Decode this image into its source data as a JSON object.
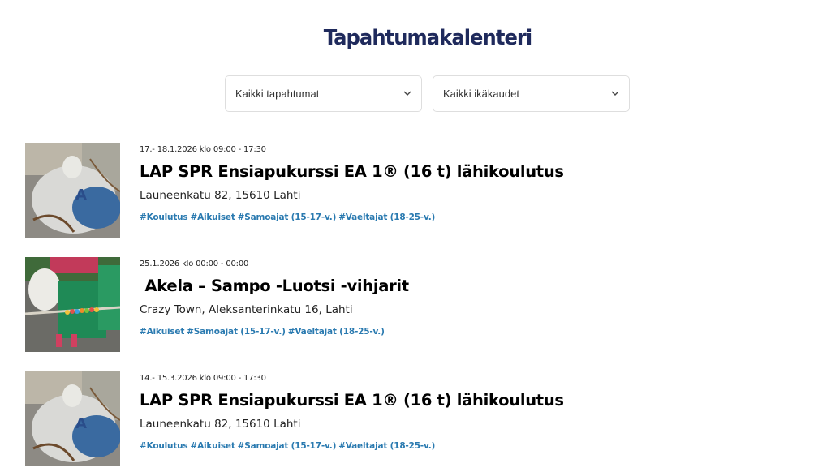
{
  "page": {
    "title": "Tapahtumakalenteri"
  },
  "filters": {
    "event_type": {
      "selected": "Kaikki tapahtumat"
    },
    "age_group": {
      "selected": "Kaikki ikäkaudet"
    }
  },
  "events": [
    {
      "date": "17.- 18.1.2026 klo 09:00 - 17:30",
      "title": "LAP SPR Ensiapukurssi EA 1® (16 t) lähikoulutus",
      "location": "Launeenkatu 82, 15610 Lahti",
      "tags": [
        "#Koulutus",
        "#Aikuiset",
        "#Samoajat (15-17-v.)",
        "#Vaeltajat (18-25-v.)"
      ]
    },
    {
      "date": "25.1.2026 klo 00:00 - 00:00",
      "title": " Akela – Sampo -Luotsi -vihjarit",
      "location": "Crazy Town, Aleksanterinkatu 16, Lahti",
      "tags": [
        "#Aikuiset",
        "#Samoajat (15-17-v.)",
        "#Vaeltajat (18-25-v.)"
      ]
    },
    {
      "date": "14.- 15.3.2026 klo 09:00 - 17:30",
      "title": "LAP SPR Ensiapukurssi EA 1® (16 t) lähikoulutus",
      "location": "Launeenkatu 82, 15610 Lahti",
      "tags": [
        "#Koulutus",
        "#Aikuiset",
        "#Samoajat (15-17-v.)",
        "#Vaeltajat (18-25-v.)"
      ]
    }
  ]
}
